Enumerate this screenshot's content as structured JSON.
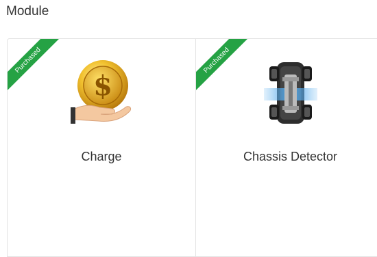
{
  "section": {
    "title": "Module"
  },
  "modules": [
    {
      "name": "Charge",
      "badge": "Purchased",
      "icon": "coin-hand-icon"
    },
    {
      "name": "Chassis Detector",
      "badge": "Purchased",
      "icon": "vehicle-chassis-icon"
    }
  ],
  "colors": {
    "ribbon": "#25a244",
    "border": "#e3e3e3",
    "text": "#333333"
  }
}
